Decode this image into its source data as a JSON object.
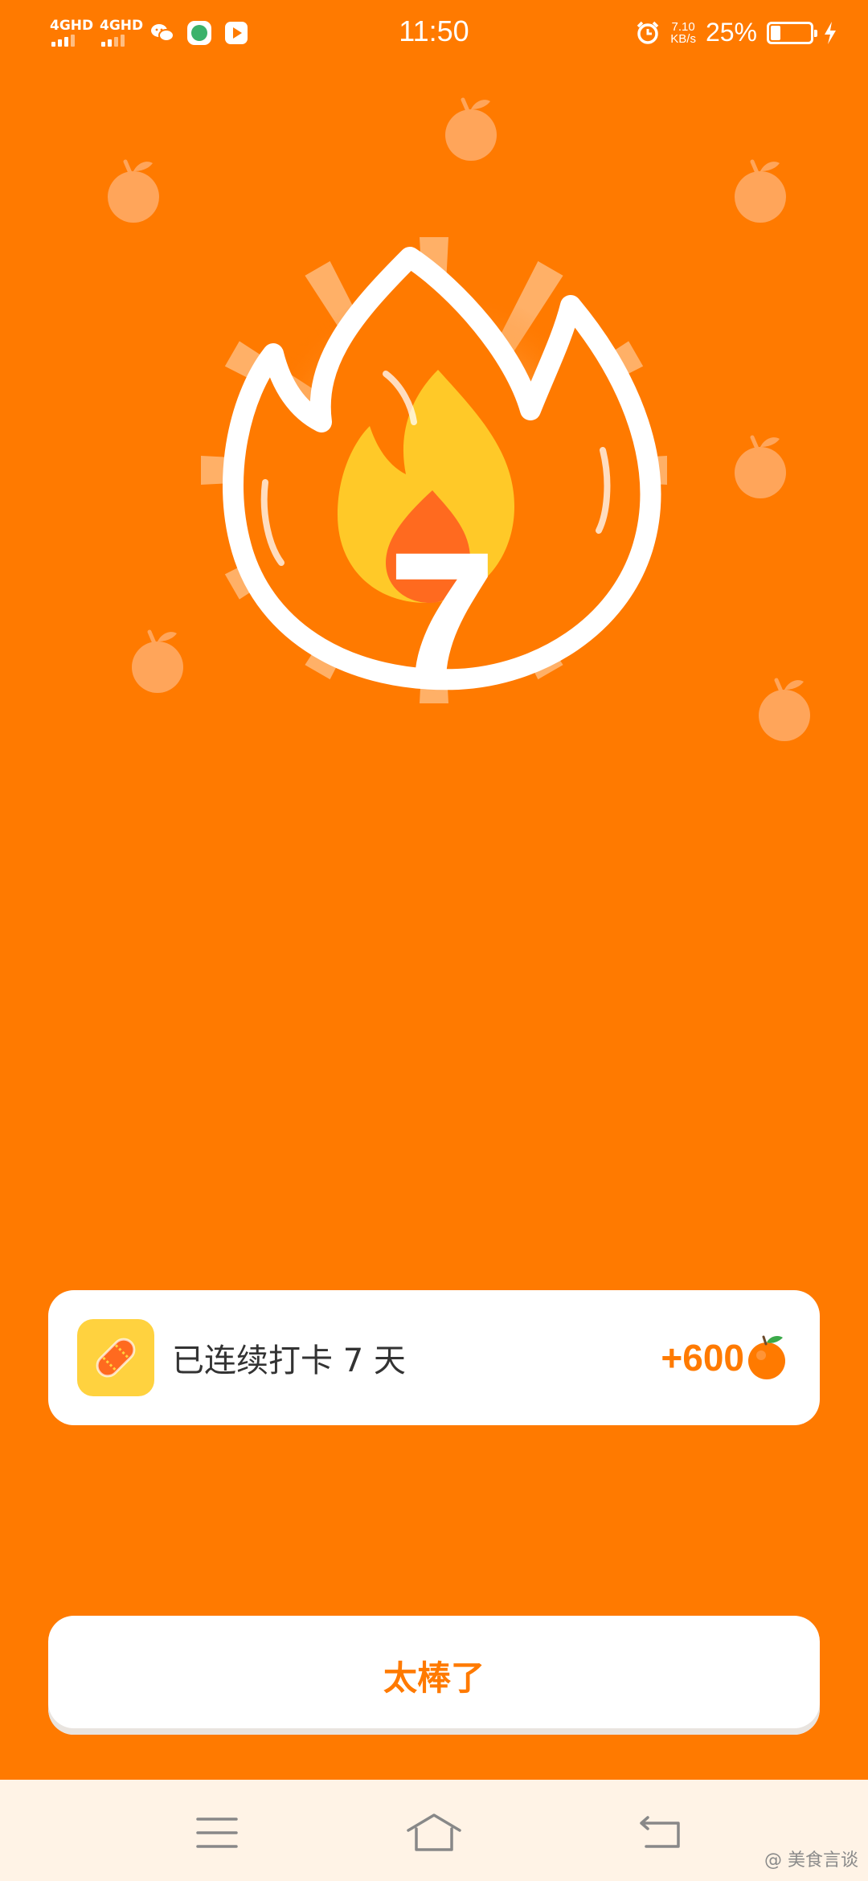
{
  "status_bar": {
    "signal_1": "4GHD",
    "signal_2": "4GHD",
    "time": "11:50",
    "net_speed_value": "7.10",
    "net_speed_unit": "KB/s",
    "battery_percent": "25%",
    "battery_level": 0.25,
    "icons": [
      "wechat-icon",
      "app-icon",
      "video-icon",
      "alarm-icon",
      "charging-icon"
    ]
  },
  "hero": {
    "streak_number": "7"
  },
  "reward_card": {
    "label": "已连续打卡 7 天",
    "amount": "+600",
    "icon": "ticket-icon",
    "coin_icon": "orange-coin-icon"
  },
  "confirm_button": {
    "label": "太棒了"
  },
  "nav_bar": {
    "icons": [
      "menu-icon",
      "home-icon",
      "back-icon"
    ]
  },
  "watermark": "@ 美食言谈",
  "colors": {
    "background": "#FF7A00",
    "accent": "#FF7A00",
    "card": "#FFFFFF",
    "nav_bar": "#FFF3E6"
  }
}
